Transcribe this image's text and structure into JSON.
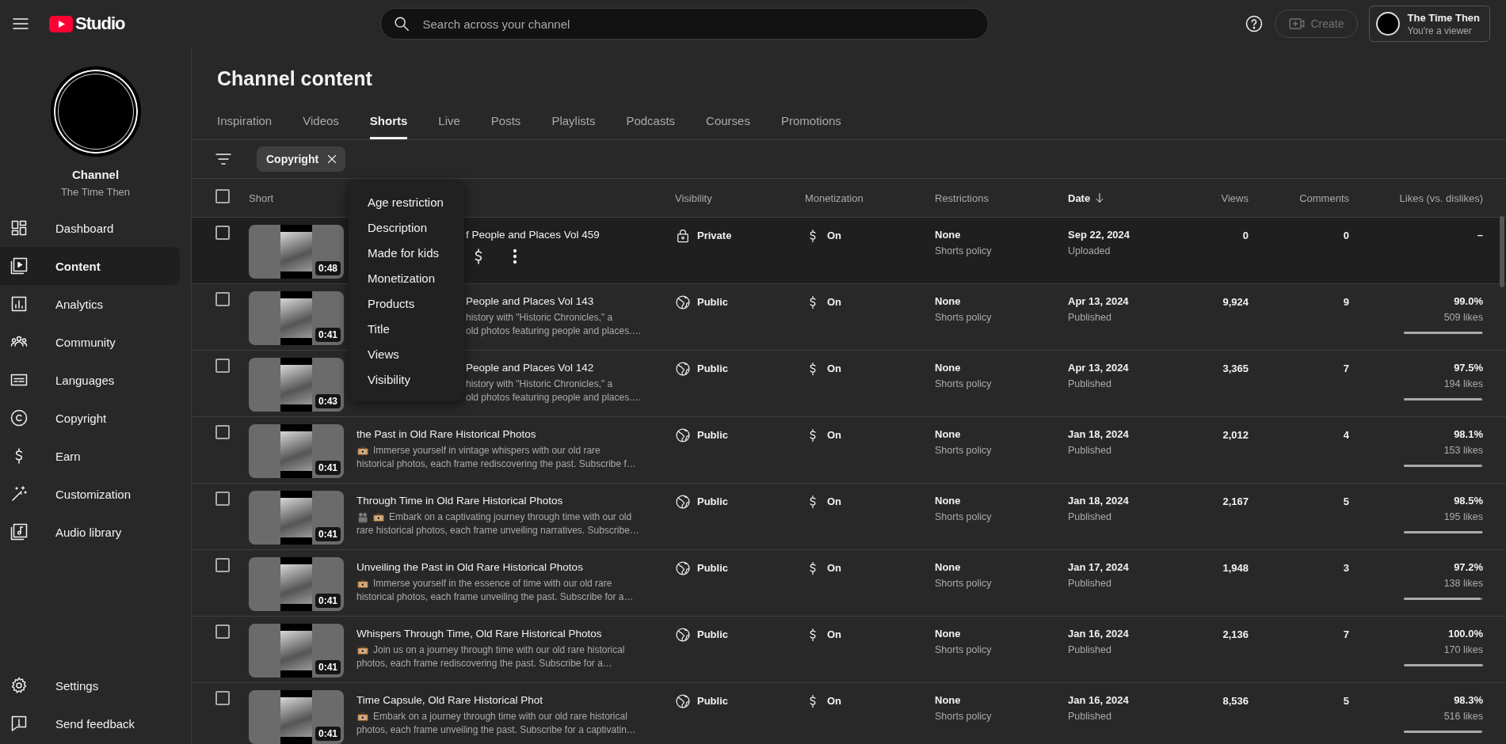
{
  "topbar": {
    "logo_text": "Studio",
    "search": {
      "placeholder": "Search across your channel"
    },
    "create": {
      "label": "Create",
      "disabled": true
    },
    "account": {
      "name": "The Time Then",
      "role": "You're a viewer"
    }
  },
  "sidebar": {
    "channel_label": "Channel",
    "channel_name": "The Time Then",
    "items": [
      {
        "label": "Dashboard",
        "selected": false
      },
      {
        "label": "Content",
        "selected": true
      },
      {
        "label": "Analytics",
        "selected": false
      },
      {
        "label": "Community",
        "selected": false
      },
      {
        "label": "Languages",
        "selected": false
      },
      {
        "label": "Copyright",
        "selected": false
      },
      {
        "label": "Earn",
        "selected": false
      },
      {
        "label": "Customization",
        "selected": false
      },
      {
        "label": "Audio library",
        "selected": false
      }
    ],
    "footer_items": [
      {
        "label": "Settings"
      },
      {
        "label": "Send feedback"
      }
    ]
  },
  "page": {
    "title": "Channel content",
    "tabs": [
      {
        "label": "Inspiration",
        "selected": false
      },
      {
        "label": "Videos",
        "selected": false
      },
      {
        "label": "Shorts",
        "selected": true
      },
      {
        "label": "Live",
        "selected": false
      },
      {
        "label": "Posts",
        "selected": false
      },
      {
        "label": "Playlists",
        "selected": false
      },
      {
        "label": "Podcasts",
        "selected": false
      },
      {
        "label": "Courses",
        "selected": false
      },
      {
        "label": "Promotions",
        "selected": false
      }
    ],
    "filters": [
      {
        "label": "Copyright"
      }
    ],
    "column_menu": {
      "items": [
        "Age restriction",
        "Description",
        "Made for kids",
        "Monetization",
        "Products",
        "Title",
        "Views",
        "Visibility"
      ]
    },
    "table": {
      "all_selected": false,
      "columns": [
        {
          "label": "Short",
          "sorted": false
        },
        {
          "label": "Visibility",
          "sorted": false
        },
        {
          "label": "Monetization",
          "sorted": false
        },
        {
          "label": "Restrictions",
          "sorted": false
        },
        {
          "label": "Date",
          "sorted": true
        },
        {
          "label": "Views",
          "sorted": false
        },
        {
          "label": "Comments",
          "sorted": false
        },
        {
          "label": "Likes (vs. dislikes)",
          "sorted": false
        }
      ],
      "rows": [
        {
          "selected": false,
          "hovered": true,
          "under_menu": true,
          "duration": "0:48",
          "title": "f People and Places Vol 459",
          "description_lines": [],
          "visibility": {
            "kind": "private",
            "label": "Private"
          },
          "monetization": "On",
          "restriction": "None",
          "restriction_note": "Shorts policy",
          "date": "Sep 22, 2024",
          "date_status": "Uploaded",
          "views": "0",
          "comments": "0",
          "likes_percent": "–"
        },
        {
          "selected": false,
          "hovered": false,
          "under_menu": true,
          "duration": "0:41",
          "title": "People and Places Vol 143",
          "description_lines": [
            "history with \"Historic Chronicles,\" a",
            "old photos featuring people and places.…"
          ],
          "visibility": {
            "kind": "public",
            "label": "Public"
          },
          "monetization": "On",
          "restriction": "None",
          "restriction_note": "Shorts policy",
          "date": "Apr 13, 2024",
          "date_status": "Published",
          "views": "9,924",
          "comments": "9",
          "likes_percent": "99.0%",
          "likes_count": "509 likes",
          "level": 0.99
        },
        {
          "selected": false,
          "hovered": false,
          "under_menu": true,
          "duration": "0:43",
          "title": "People and Places Vol 142",
          "description_lines": [
            "history with \"Historic Chronicles,\" a",
            "old photos featuring people and places.…"
          ],
          "visibility": {
            "kind": "public",
            "label": "Public"
          },
          "monetization": "On",
          "restriction": "None",
          "restriction_note": "Shorts policy",
          "date": "Apr 13, 2024",
          "date_status": "Published",
          "views": "3,365",
          "comments": "7",
          "likes_percent": "97.5%",
          "likes_count": "194 likes",
          "level": 0.975
        },
        {
          "selected": false,
          "hovered": false,
          "under_menu": false,
          "duration": "0:41",
          "title": "the Past in Old Rare Historical Photos",
          "description_lines": [
            "Immerse yourself in vintage whispers with our old rare",
            "historical photos, each frame rediscovering the past. Subscribe f…"
          ],
          "visibility": {
            "kind": "public",
            "label": "Public"
          },
          "monetization": "On",
          "restriction": "None",
          "restriction_note": "Shorts policy",
          "date": "Jan 18, 2024",
          "date_status": "Published",
          "views": "2,012",
          "comments": "4",
          "likes_percent": "98.1%",
          "likes_count": "153 likes",
          "level": 0.981
        },
        {
          "selected": false,
          "hovered": false,
          "under_menu": false,
          "duration": "0:41",
          "title": "Through Time in Old Rare Historical Photos",
          "description_lines": [
            "Embark on a captivating journey through time with our old",
            "rare historical photos, each frame unveiling narratives. Subscribe…"
          ],
          "visibility": {
            "kind": "public",
            "label": "Public"
          },
          "monetization": "On",
          "restriction": "None",
          "restriction_note": "Shorts policy",
          "date": "Jan 18, 2024",
          "date_status": "Published",
          "views": "2,167",
          "comments": "5",
          "likes_percent": "98.5%",
          "likes_count": "195 likes",
          "level": 0.985
        },
        {
          "selected": false,
          "hovered": false,
          "under_menu": false,
          "duration": "0:41",
          "title": "Unveiling the Past in Old Rare Historical Photos",
          "description_lines": [
            "Immerse yourself in the essence of time with our old rare",
            "historical photos, each frame unveiling the past. Subscribe for a…"
          ],
          "visibility": {
            "kind": "public",
            "label": "Public"
          },
          "monetization": "On",
          "restriction": "None",
          "restriction_note": "Shorts policy",
          "date": "Jan 17, 2024",
          "date_status": "Published",
          "views": "1,948",
          "comments": "3",
          "likes_percent": "97.2%",
          "likes_count": "138 likes",
          "level": 0.972
        },
        {
          "selected": false,
          "hovered": false,
          "under_menu": false,
          "duration": "0:41",
          "title": "Whispers Through Time, Old Rare Historical Photos",
          "description_lines": [
            "Join us on a journey through time with our old rare historical",
            "photos, each frame rediscovering the past. Subscribe for a…"
          ],
          "visibility": {
            "kind": "public",
            "label": "Public"
          },
          "monetization": "On",
          "restriction": "None",
          "restriction_note": "Shorts policy",
          "date": "Jan 16, 2024",
          "date_status": "Published",
          "views": "2,136",
          "comments": "7",
          "likes_percent": "100.0%",
          "likes_count": "170 likes",
          "level": 1.0
        },
        {
          "selected": false,
          "hovered": false,
          "under_menu": false,
          "duration": "0:41",
          "title": "Time Capsule, Old Rare Historical Phot",
          "description_lines": [
            "Embark on a journey through time with our old rare historical",
            "photos, each frame unveiling the past. Subscribe for a captivatin…"
          ],
          "visibility": {
            "kind": "public",
            "label": "Public"
          },
          "monetization": "On",
          "restriction": "None",
          "restriction_note": "Shorts policy",
          "date": "Jan 16, 2024",
          "date_status": "Published",
          "views": "8,536",
          "comments": "5",
          "likes_percent": "98.3%",
          "likes_count": "516 likes",
          "level": 0.983
        }
      ]
    }
  }
}
